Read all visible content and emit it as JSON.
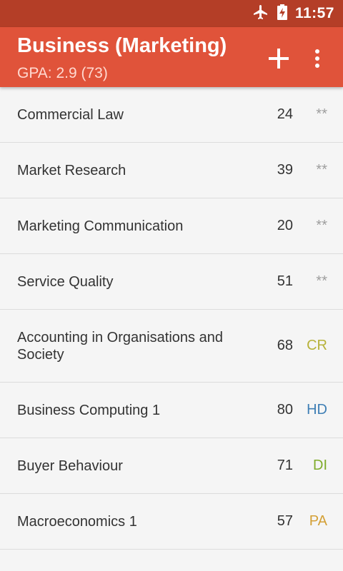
{
  "status_bar": {
    "time": "11:57",
    "icons": [
      "airplane-mode-icon",
      "battery-charging-icon"
    ]
  },
  "app_bar": {
    "title": "Business (Marketing)",
    "subtitle": "GPA: 2.9 (73)",
    "actions": [
      "add-icon",
      "more-vert-icon"
    ]
  },
  "courses": [
    {
      "name": "Commercial Law",
      "score": "24",
      "grade": "**",
      "grade_color": "#9e9e9e"
    },
    {
      "name": "Market Research",
      "score": "39",
      "grade": "**",
      "grade_color": "#9e9e9e"
    },
    {
      "name": "Marketing Communication",
      "score": "20",
      "grade": "**",
      "grade_color": "#9e9e9e"
    },
    {
      "name": "Service Quality",
      "score": "51",
      "grade": "**",
      "grade_color": "#9e9e9e"
    },
    {
      "name": "Accounting in Organisations and Society",
      "score": "68",
      "grade": "CR",
      "grade_color": "#b7b23a"
    },
    {
      "name": "Business Computing 1",
      "score": "80",
      "grade": "HD",
      "grade_color": "#3f7fb5"
    },
    {
      "name": "Buyer Behaviour",
      "score": "71",
      "grade": "DI",
      "grade_color": "#7fac2a"
    },
    {
      "name": "Macroeconomics 1",
      "score": "57",
      "grade": "PA",
      "grade_color": "#d4a036"
    }
  ],
  "colors": {
    "status_bar": "#b43e27",
    "app_bar": "#e0533a",
    "background": "#f5f5f5"
  }
}
